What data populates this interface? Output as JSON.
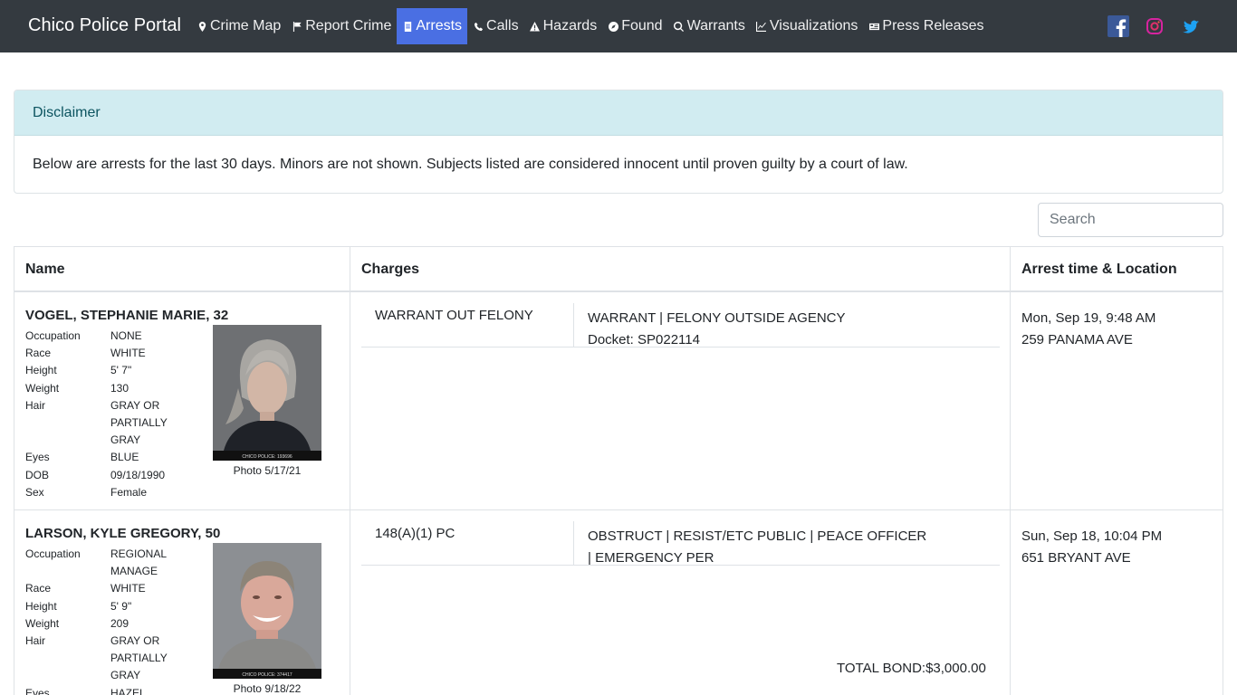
{
  "brand": "Chico Police Portal",
  "nav": [
    {
      "label": "Crime Map",
      "icon": "map-marker-icon"
    },
    {
      "label": "Report Crime",
      "icon": "flag-icon"
    },
    {
      "label": "Arrests",
      "icon": "document-icon",
      "active": true
    },
    {
      "label": "Calls",
      "icon": "phone-icon"
    },
    {
      "label": "Hazards",
      "icon": "warning-icon"
    },
    {
      "label": "Found",
      "icon": "compass-icon"
    },
    {
      "label": "Warrants",
      "icon": "search-icon"
    },
    {
      "label": "Visualizations",
      "icon": "chart-icon"
    },
    {
      "label": "Press Releases",
      "icon": "newspaper-icon"
    }
  ],
  "social": [
    "facebook-icon",
    "instagram-icon",
    "twitter-icon"
  ],
  "colors": {
    "navbar": "#343a40",
    "active_nav": "#4a6fe3",
    "disclaimer_bg": "#d1ecf1",
    "disclaimer_text": "#0c5460"
  },
  "disclaimer": {
    "title": "Disclaimer",
    "body": "Below are arrests for the last 30 days. Minors are not shown. Subjects listed are considered innocent until proven guilty by a court of law."
  },
  "search": {
    "placeholder": "Search"
  },
  "table": {
    "headers": {
      "name": "Name",
      "charges": "Charges",
      "arrest": "Arrest time & Location"
    },
    "rows": [
      {
        "name": "VOGEL, STEPHANIE MARIE, 32",
        "details": [
          {
            "k": "Occupation",
            "v": "NONE"
          },
          {
            "k": "Race",
            "v": "WHITE"
          },
          {
            "k": "Height",
            "v": "5' 7\""
          },
          {
            "k": "Weight",
            "v": "130"
          },
          {
            "k": "Hair",
            "v": "GRAY OR PARTIALLY GRAY"
          },
          {
            "k": "Eyes",
            "v": "BLUE"
          },
          {
            "k": "DOB",
            "v": "09/18/1990"
          },
          {
            "k": "Sex",
            "v": "Female"
          }
        ],
        "photo_label": "CHICO POLICE: 193696",
        "photo_caption": "Photo 5/17/21",
        "charge_code": "WARRANT OUT FELONY",
        "charge_desc": "WARRANT | FELONY OUTSIDE AGENCY",
        "docket": "Docket: SP022114",
        "arrest_time": "Mon, Sep 19, 9:48 AM",
        "arrest_location": "259 PANAMA AVE"
      },
      {
        "name": "LARSON, KYLE GREGORY, 50",
        "details": [
          {
            "k": "Occupation",
            "v": "REGIONAL MANAGE"
          },
          {
            "k": "Race",
            "v": "WHITE"
          },
          {
            "k": "Height",
            "v": "5' 9\""
          },
          {
            "k": "Weight",
            "v": "209"
          },
          {
            "k": "Hair",
            "v": "GRAY OR PARTIALLY GRAY"
          },
          {
            "k": "Eyes",
            "v": "HAZEL"
          }
        ],
        "photo_label": "CHICO POLICE: 374417",
        "photo_caption": "Photo 9/18/22",
        "charge_code": "148(A)(1) PC",
        "charge_desc": "OBSTRUCT | RESIST/ETC PUBLIC | PEACE OFFICER | EMERGENCY PER",
        "arrest_time": "Sun, Sep 18, 10:04 PM",
        "arrest_location": "651 BRYANT AVE",
        "total_bond": "TOTAL BOND:$3,000.00"
      }
    ]
  }
}
